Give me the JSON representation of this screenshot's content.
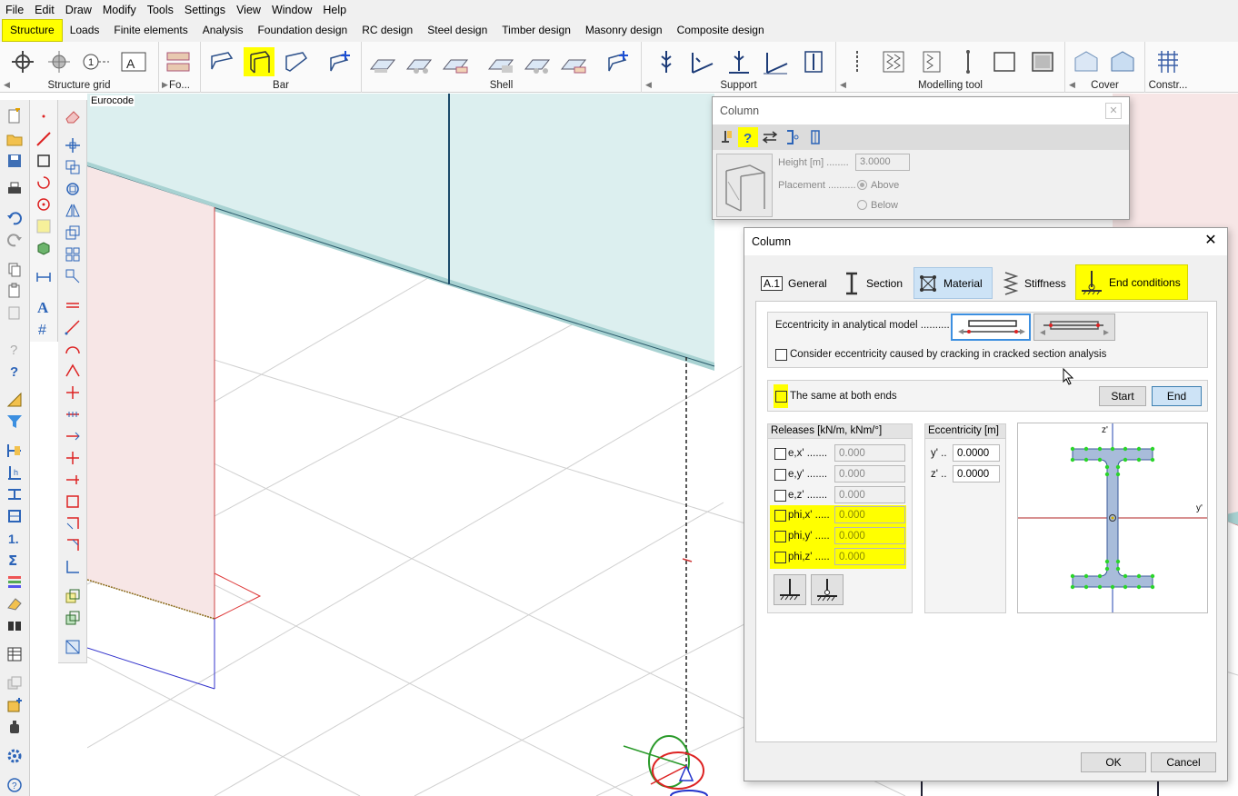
{
  "menu": [
    "File",
    "Edit",
    "Draw",
    "Modify",
    "Tools",
    "Settings",
    "View",
    "Window",
    "Help"
  ],
  "tabs": [
    "Structure",
    "Loads",
    "Finite elements",
    "Analysis",
    "Foundation design",
    "RC design",
    "Steel design",
    "Timber design",
    "Masonry design",
    "Composite design"
  ],
  "active_tab": "Structure",
  "ribbon_groups": [
    "Structure grid",
    "Fo...",
    "Bar",
    "Shell",
    "Support",
    "Modelling tool",
    "Cover",
    "Constr..."
  ],
  "standard_label": "Eurocode",
  "small_dialog": {
    "title": "Column",
    "height_label": "Height [m] ........",
    "height_value": "3.0000",
    "placement_label": "Placement ..........",
    "above": "Above",
    "below": "Below"
  },
  "main_dialog": {
    "title": "Column",
    "close": "✕",
    "tabs": [
      {
        "icon": "A.1",
        "label": "General"
      },
      {
        "label": "Section"
      },
      {
        "label": "Material"
      },
      {
        "label": "Stiffness"
      },
      {
        "label": "End conditions"
      }
    ],
    "eccentricity_label": "Eccentricity in analytical model ..........",
    "cracking_label": "Consider eccentricity caused by cracking in cracked section analysis",
    "same_both_ends": "The same at both ends",
    "start_btn": "Start",
    "end_btn": "End",
    "releases_header": "Releases [kN/m, kNm/°]",
    "releases": [
      {
        "label": "e,x' .......",
        "value": "0.000"
      },
      {
        "label": "e,y' .......",
        "value": "0.000"
      },
      {
        "label": "e,z' .......",
        "value": "0.000"
      },
      {
        "label": "phi,x' .....",
        "value": "0.000"
      },
      {
        "label": "phi,y' .....",
        "value": "0.000"
      },
      {
        "label": "phi,z' .....",
        "value": "0.000"
      }
    ],
    "ecc_header": "Eccentricity [m]",
    "ecc": [
      {
        "label": "y' ..",
        "value": "0.0000"
      },
      {
        "label": "z' ..",
        "value": "0.0000"
      }
    ],
    "section_axis_z": "z'",
    "section_axis_y": "y'",
    "ok": "OK",
    "cancel": "Cancel"
  }
}
